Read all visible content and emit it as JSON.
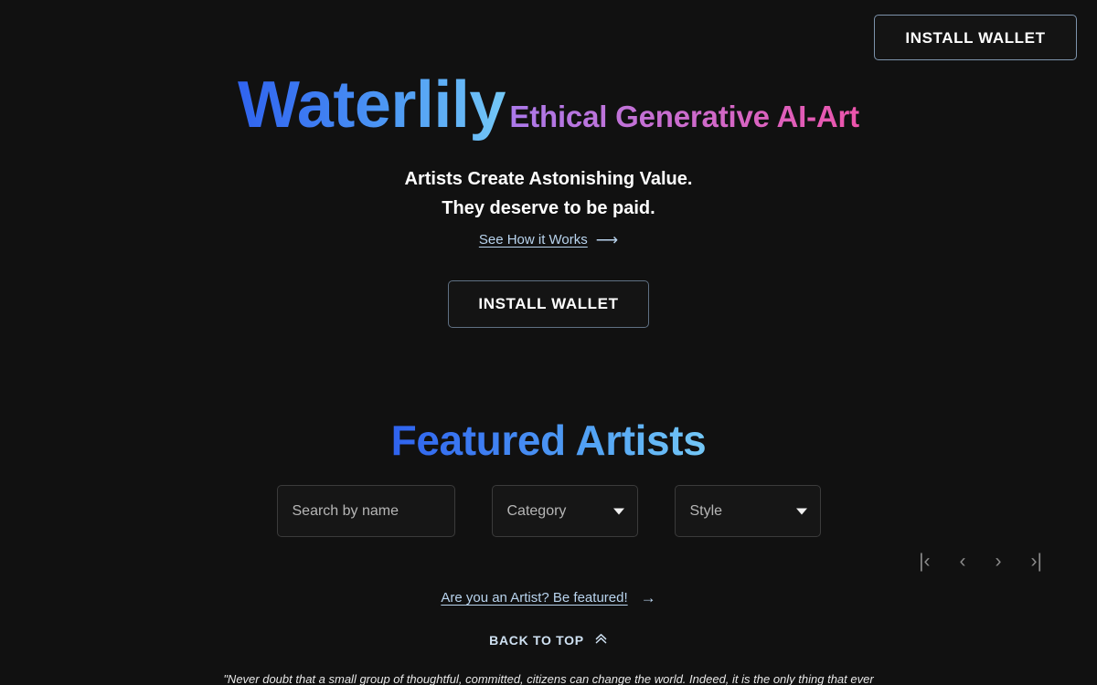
{
  "header": {
    "install_wallet_label": "INSTALL WALLET"
  },
  "hero": {
    "brand_title": "Waterlily",
    "brand_subtitle": "Ethical Generative AI-Art",
    "tagline_line1": "Artists Create Astonishing Value.",
    "tagline_line2": "They deserve to be paid.",
    "how_it_works_label": "See How it Works",
    "how_it_works_arrow": "⟶",
    "install_wallet_label": "INSTALL WALLET"
  },
  "featured": {
    "title": "Featured Artists",
    "search_placeholder": "Search by name",
    "search_value": "",
    "category_label": "Category",
    "style_label": "Style"
  },
  "pagination": {
    "first_label": "|‹",
    "prev_label": "‹",
    "next_label": "›",
    "last_label": "›|"
  },
  "footer": {
    "artist_link_label": "Are you an Artist? Be featured!",
    "artist_link_arrow": "→",
    "back_to_top_label": "BACK TO TOP",
    "back_to_top_icon": "«",
    "quote": "\"Never doubt that a small group of thoughtful, committed, citizens can change the world. Indeed, it is the only thing that ever"
  },
  "colors": {
    "background": "#111111",
    "brand_gradient_start": "#3064ef",
    "brand_gradient_end": "#74c8f7",
    "subtitle_gradient_start": "#ab79ea",
    "subtitle_gradient_end": "#ec54ab",
    "link_blue": "#b9d4ee",
    "border_gray": "#3b3b3b",
    "button_border": "#7d93ab"
  }
}
